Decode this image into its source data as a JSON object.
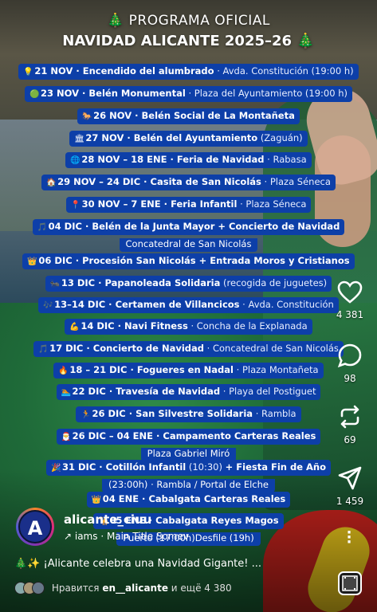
{
  "header": {
    "line1": "🎄 PROGRAMA OFICIAL",
    "line2": "NAVIDAD ALICANTE 2025–26 🎄"
  },
  "events": [
    {
      "icon": "💡",
      "date": "21 NOV",
      "title": "Encendido del alumbrado",
      "place": "Avda. Constitución (19:00 h)"
    },
    {
      "icon": "🟢",
      "date": "23 NOV",
      "title": "Belén Monumental",
      "place": "Plaza del Ayuntamiento (19:00 h)"
    },
    {
      "icon": "🐎",
      "date": "26 NOV",
      "title": "Belén  Social de La Montañeta",
      "place": ""
    },
    {
      "icon": "🏛",
      "date": "27 NOV",
      "title": "Belén del Ayuntamiento",
      "place": "(Zaguán)"
    },
    {
      "icon": "🌐",
      "date": "28 NOV – 18 ENE",
      "title": "Feria de Navidad",
      "place": "Rabasa"
    },
    {
      "icon": "🏠",
      "date": "29 NOV – 24 DIC",
      "title": "Casita de San Nicolás",
      "place": "Plaza Séneca"
    },
    {
      "icon": "📍",
      "date": "30 NOV – 7 ENE",
      "title": "Feria Infantil",
      "place": "Plaza Séneca"
    },
    {
      "icon": "🎵",
      "date": "04 DIC",
      "title": "Belén de la Junta Mayor + Concierto de Navidad",
      "place": "",
      "sub": "Concatedral de San Nicolás"
    },
    {
      "icon": "👑",
      "date": "06 DIC",
      "title": "Procesión San Nicolás + Entrada  Moros y Cristianos",
      "place": ""
    },
    {
      "icon": "🐜",
      "date": "13 DIC",
      "title": "Papanoleada Solidaria",
      "place": "(recogida de juguetes)"
    },
    {
      "icon": "🎶",
      "date": "13–14 DIC",
      "title": "Certamen de Villancicos",
      "place": "Avda. Constitución"
    },
    {
      "icon": "💪",
      "date": "14 DIC",
      "title": "Navi Fitness",
      "place": "Concha de la Explanada"
    },
    {
      "icon": "🎵",
      "date": "17 DIC",
      "title": "Concierto de Navidad",
      "place": "Concatedral de San Nicolás"
    },
    {
      "icon": "🔥",
      "date": "18 – 21 DIC",
      "title": "Fogueres en Nadal",
      "place": "Plaza Montañeta"
    },
    {
      "icon": "🏊",
      "date": "22 DIC",
      "title": "Travesía de Navidad",
      "place": "Playa del Postiguet"
    },
    {
      "icon": "🏃",
      "date": "26 DIC",
      "title": "San Silvestre Solidaria",
      "place": "Rambla"
    },
    {
      "icon": "🎅",
      "date": "26 DIC – 04 ENE",
      "title": "Campamento Carteras Reales",
      "place": "",
      "sub": "Plaza Gabriel Miró"
    },
    {
      "icon": "🎉",
      "date": "31 DIC",
      "title": "Cotillón Infantil",
      "place": "(10:30)",
      "extra": "+ Fiesta Fin de Año",
      "sub": "(23:00h) · Rambla / Portal de Elche"
    },
    {
      "icon": "👑",
      "date": "04 ENE",
      "title": "Cabalgata Carteras Reales",
      "place": ""
    },
    {
      "icon": "🐪",
      "date": "05 ENE",
      "title": "Cabalgata Reyes Magos",
      "place": "",
      "sub": "Puerto (17:00h)Desfile (19h)"
    }
  ],
  "actions": {
    "like_count": "4 381",
    "comment_count": "98",
    "repost_count": "69",
    "share_count": "1 459"
  },
  "footer": {
    "avatar_letter": "A",
    "username": "alicante_ciuu",
    "music": "↗ iams · Main Title  Somev",
    "caption": "🎄✨ ¡Alicante celebra una Navidad Gigante! ...",
    "likes_prefix": "Нравится ",
    "likes_user": "en__alicante",
    "likes_suffix": " и ещё 4 380"
  }
}
